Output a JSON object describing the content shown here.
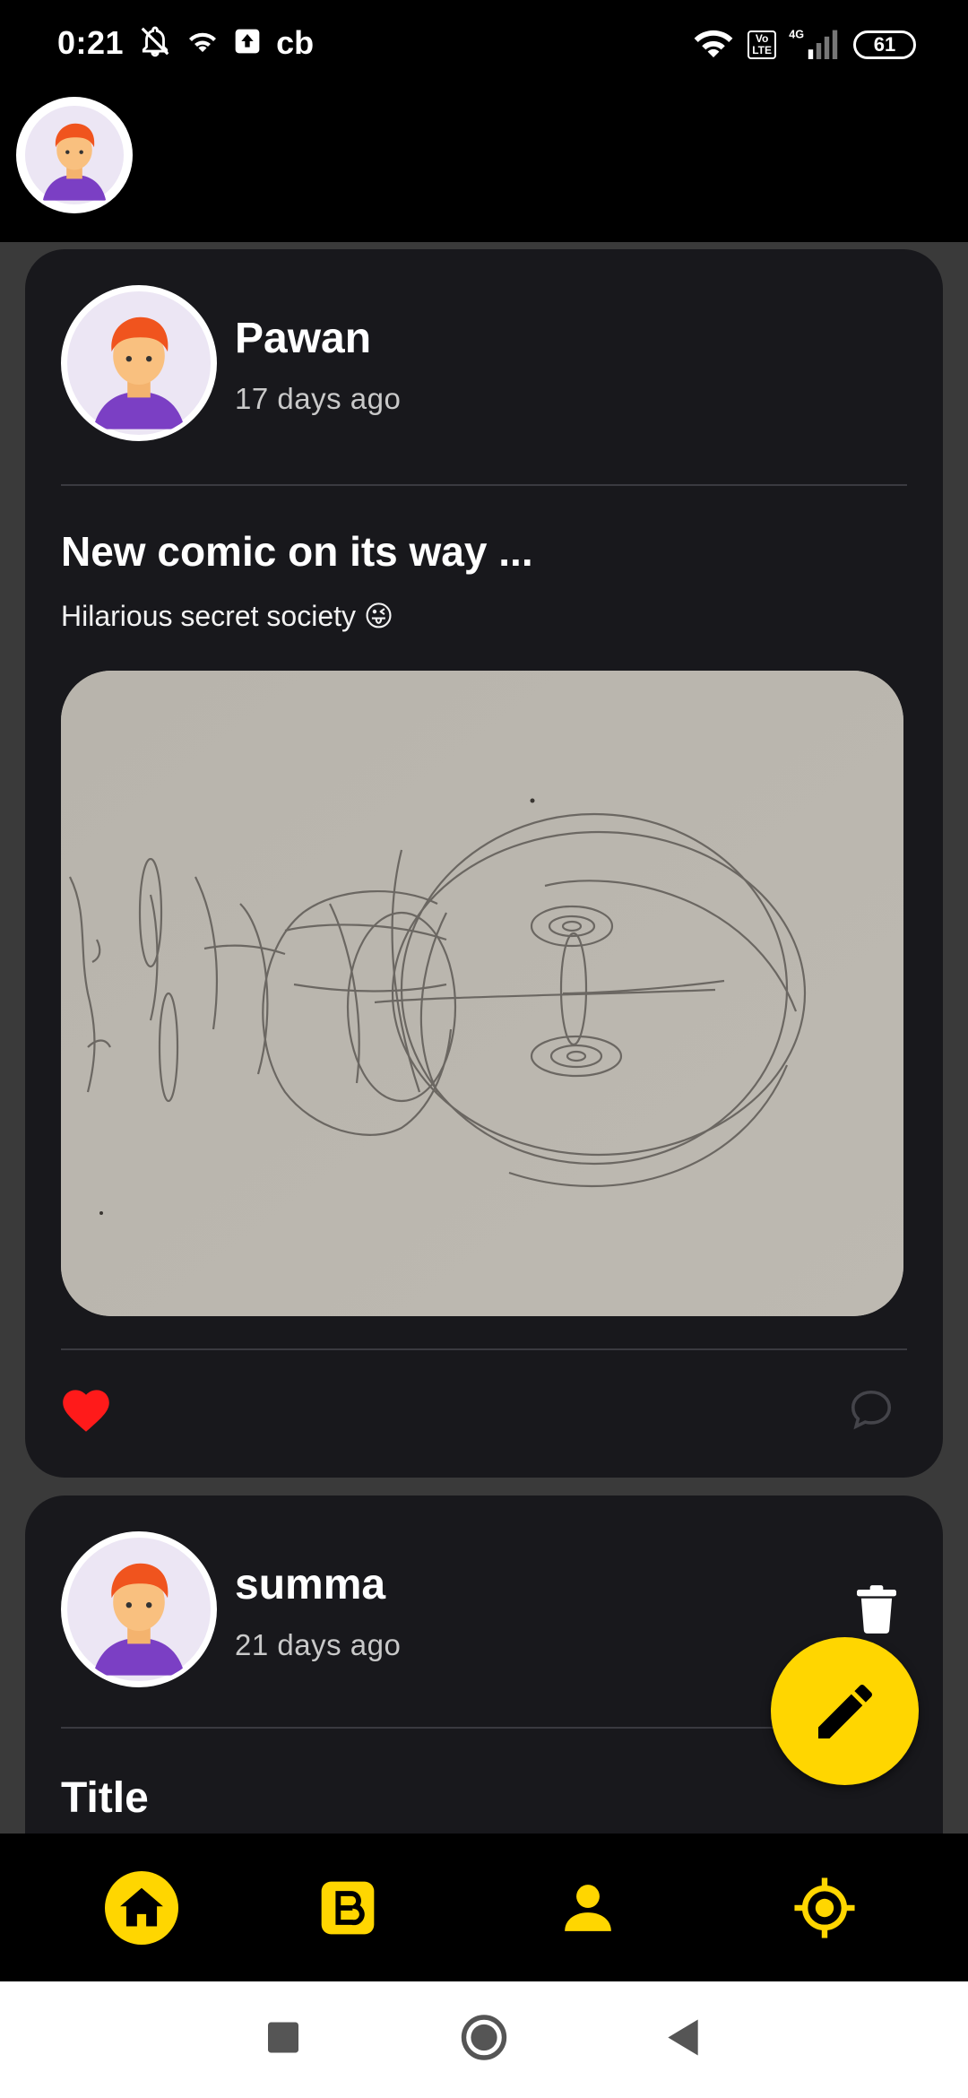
{
  "status_bar": {
    "time": "0:21",
    "app_badge": "cb",
    "volte": "Vo\nLTE",
    "network": "4G",
    "battery": "61"
  },
  "colors": {
    "accent": "#ffd600",
    "like": "#ff1a1a",
    "card": "#18181c",
    "feed_bg": "#3a3a3a"
  },
  "posts": [
    {
      "author": "Pawan",
      "time": "17 days ago",
      "title": "New comic on its way ...",
      "subtitle": "Hilarious secret society 😜",
      "liked": true
    },
    {
      "author": "summa",
      "time": "21 days ago",
      "title": "Title"
    }
  ],
  "icons": {
    "fab": "pencil-icon",
    "nav": [
      "home-icon",
      "blog-icon",
      "person-icon",
      "target-icon"
    ],
    "system": [
      "recents-icon",
      "home-circle-icon",
      "back-icon"
    ]
  }
}
